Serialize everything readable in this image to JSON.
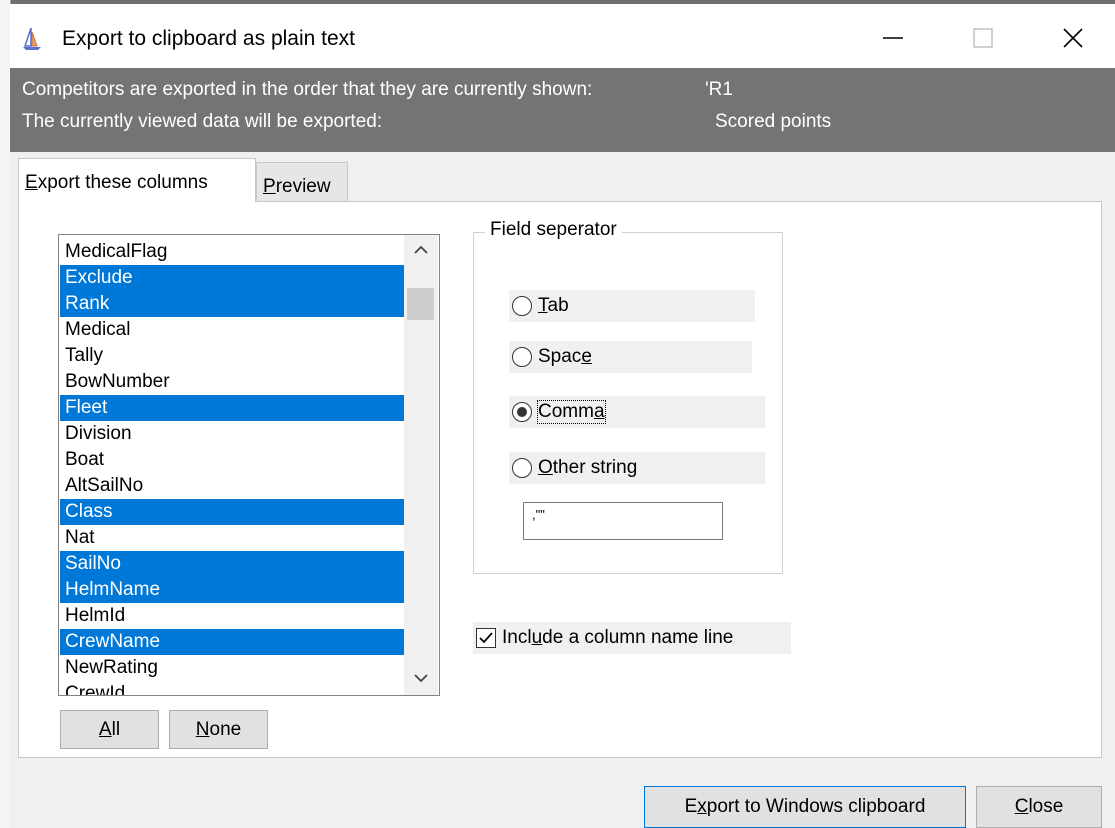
{
  "window": {
    "title": "Export to clipboard as plain text",
    "minimize_label": "—",
    "close_label": "✕"
  },
  "info": {
    "line1_label": "Competitors are exported in the order that they are currently shown:",
    "line1_value": "'R1",
    "line2_label": "The currently viewed data will be exported:",
    "line2_value": "Scored points"
  },
  "tabs": [
    {
      "prefix": "",
      "accel": "E",
      "rest": "xport these columns",
      "active": true
    },
    {
      "prefix": "",
      "accel": "P",
      "rest": "review",
      "active": false
    }
  ],
  "columns": {
    "items": [
      {
        "label": "MedicalFlag",
        "selected": false
      },
      {
        "label": "Exclude",
        "selected": true
      },
      {
        "label": "Rank",
        "selected": true
      },
      {
        "label": "Medical",
        "selected": false
      },
      {
        "label": "Tally",
        "selected": false
      },
      {
        "label": "BowNumber",
        "selected": false
      },
      {
        "label": "Fleet",
        "selected": true
      },
      {
        "label": "Division",
        "selected": false
      },
      {
        "label": "Boat",
        "selected": false
      },
      {
        "label": "AltSailNo",
        "selected": false
      },
      {
        "label": "Class",
        "selected": true
      },
      {
        "label": "Nat",
        "selected": false
      },
      {
        "label": "SailNo",
        "selected": true
      },
      {
        "label": "HelmName",
        "selected": true
      },
      {
        "label": "HelmId",
        "selected": false
      },
      {
        "label": "CrewName",
        "selected": true
      },
      {
        "label": "NewRating",
        "selected": false
      },
      {
        "label": "CrewId",
        "selected": false
      }
    ],
    "scroll_position": 0.05
  },
  "buttons": {
    "all": {
      "prefix": "",
      "accel": "A",
      "rest": "ll"
    },
    "none": {
      "prefix": "",
      "accel": "N",
      "rest": "one"
    },
    "export": {
      "prefix": "E",
      "accel": "x",
      "rest": "port to Windows clipboard"
    },
    "close": {
      "prefix": "",
      "accel": "C",
      "rest": "lose"
    }
  },
  "separator": {
    "title": "Field seperator",
    "options": [
      {
        "prefix": "",
        "accel": "T",
        "rest": "ab",
        "checked": false
      },
      {
        "prefix": "Spac",
        "accel": "e",
        "rest": "",
        "checked": false
      },
      {
        "prefix": "Comm",
        "accel": "a",
        "rest": "",
        "checked": true
      },
      {
        "prefix": "",
        "accel": "O",
        "rest": "ther string",
        "checked": false
      }
    ],
    "other_value": ",\"\""
  },
  "include_header": {
    "prefix": "Incl",
    "accel": "u",
    "rest": "de a column name line",
    "checked": true
  }
}
